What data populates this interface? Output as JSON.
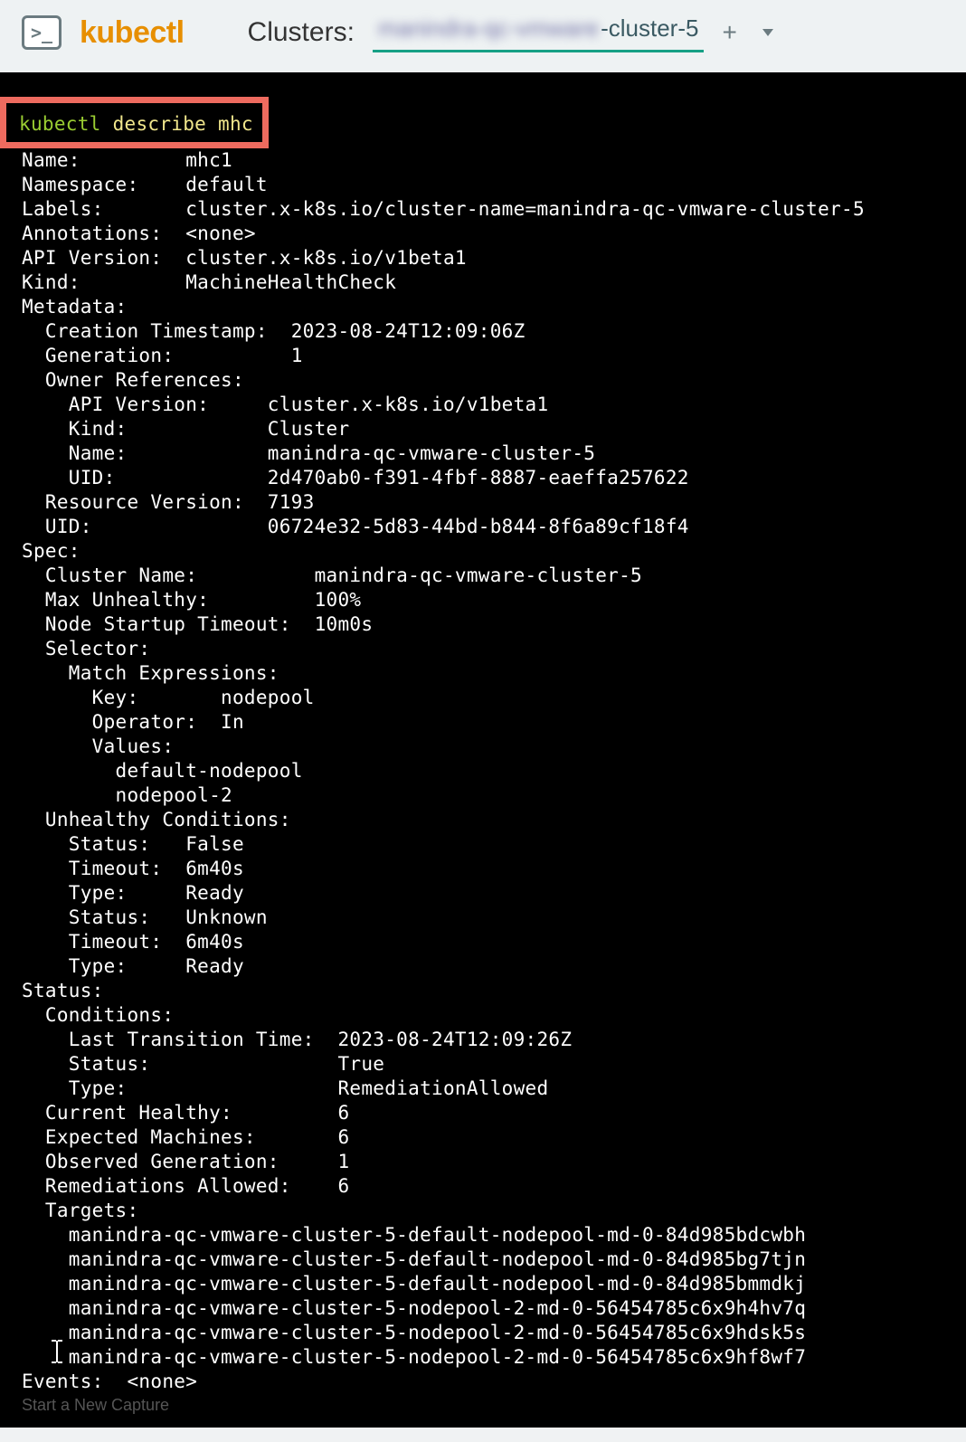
{
  "topbar": {
    "brand": "kubectl",
    "clusters_label": "Clusters:",
    "active_cluster_obscured": "manindra-qc-vmware",
    "active_cluster_visible": "-cluster-5",
    "plus": "+"
  },
  "command": {
    "keyword": "kubectl",
    "args": "describe mhc"
  },
  "output": {
    "name": "Name:         mhc1",
    "namespace": "Namespace:    default",
    "labels": "Labels:       cluster.x-k8s.io/cluster-name=manindra-qc-vmware-cluster-5",
    "annotations": "Annotations:  <none>",
    "api_version": "API Version:  cluster.x-k8s.io/v1beta1",
    "kind": "Kind:         MachineHealthCheck",
    "metadata_hdr": "Metadata:",
    "creation_ts": "  Creation Timestamp:  2023-08-24T12:09:06Z",
    "generation": "  Generation:          1",
    "owner_refs_hdr": "  Owner References:",
    "or_api": "    API Version:     cluster.x-k8s.io/v1beta1",
    "or_kind": "    Kind:            Cluster",
    "or_name": "    Name:            manindra-qc-vmware-cluster-5",
    "or_uid": "    UID:             2d470ab0-f391-4fbf-8887-eaeffa257622",
    "res_ver": "  Resource Version:  7193",
    "uid": "  UID:               06724e32-5d83-44bd-b844-8f6a89cf18f4",
    "spec_hdr": "Spec:",
    "cluster_name": "  Cluster Name:          manindra-qc-vmware-cluster-5",
    "max_unhealthy": "  Max Unhealthy:         100%",
    "node_startup": "  Node Startup Timeout:  10m0s",
    "selector_hdr": "  Selector:",
    "me_hdr": "    Match Expressions:",
    "me_key": "      Key:       nodepool",
    "me_op": "      Operator:  In",
    "me_vals_hdr": "      Values:",
    "me_val1": "        default-nodepool",
    "me_val2": "        nodepool-2",
    "uc_hdr": "  Unhealthy Conditions:",
    "uc1_status": "    Status:   False",
    "uc1_timeout": "    Timeout:  6m40s",
    "uc1_type": "    Type:     Ready",
    "uc2_status": "    Status:   Unknown",
    "uc2_timeout": "    Timeout:  6m40s",
    "uc2_type": "    Type:     Ready",
    "status_hdr": "Status:",
    "cond_hdr": "  Conditions:",
    "ltt": "    Last Transition Time:  2023-08-24T12:09:26Z",
    "cond_status": "    Status:                True",
    "cond_type": "    Type:                  RemediationAllowed",
    "cur_healthy": "  Current Healthy:         6",
    "exp_machines": "  Expected Machines:       6",
    "obs_gen": "  Observed Generation:     1",
    "rem_allowed": "  Remediations Allowed:    6",
    "targets_hdr": "  Targets:",
    "t1": "    manindra-qc-vmware-cluster-5-default-nodepool-md-0-84d985bdcwbh",
    "t2": "    manindra-qc-vmware-cluster-5-default-nodepool-md-0-84d985bg7tjn",
    "t3": "    manindra-qc-vmware-cluster-5-default-nodepool-md-0-84d985bmmdkj",
    "t4": "    manindra-qc-vmware-cluster-5-nodepool-2-md-0-56454785c6x9h4hv7q",
    "t5": "    manindra-qc-vmware-cluster-5-nodepool-2-md-0-56454785c6x9hdsk5s",
    "t6": "    manindra-qc-vmware-cluster-5-nodepool-2-md-0-56454785c6x9hf8wf7",
    "events": "Events:  <none>"
  },
  "overlay_hint": "Start a New Capture"
}
